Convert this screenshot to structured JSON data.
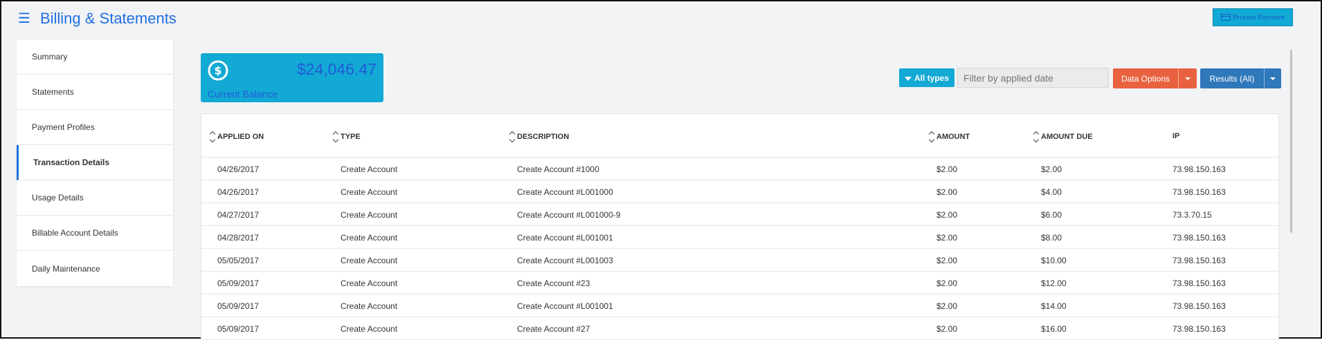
{
  "header": {
    "title": "Billing & Statements",
    "process_payment_label": "Process Payment"
  },
  "sidebar": {
    "items": [
      {
        "label": "Summary"
      },
      {
        "label": "Statements"
      },
      {
        "label": "Payment Profiles"
      },
      {
        "label": "Transaction Details"
      },
      {
        "label": "Usage Details"
      },
      {
        "label": "Billable Account Details"
      },
      {
        "label": "Daily Maintenance"
      }
    ],
    "active_index": 3
  },
  "balance": {
    "amount": "$24,046.47",
    "label": "Current Balance"
  },
  "toolbar": {
    "all_types_label": "All types",
    "date_filter_placeholder": "Filter by applied date",
    "data_options_label": "Data Options",
    "results_label": "Results (All)"
  },
  "table": {
    "columns": [
      "APPLIED ON",
      "TYPE",
      "DESCRIPTION",
      "AMOUNT",
      "AMOUNT DUE",
      "IP"
    ],
    "rows": [
      [
        "04/26/2017",
        "Create Account",
        "Create Account #1000",
        "$2.00",
        "$2.00",
        "73.98.150.163"
      ],
      [
        "04/26/2017",
        "Create Account",
        "Create Account #L001000",
        "$2.00",
        "$4.00",
        "73.98.150.163"
      ],
      [
        "04/27/2017",
        "Create Account",
        "Create Account #L001000-9",
        "$2.00",
        "$6.00",
        "73.3.70.15"
      ],
      [
        "04/28/2017",
        "Create Account",
        "Create Account #L001001",
        "$2.00",
        "$8.00",
        "73.98.150.163"
      ],
      [
        "05/05/2017",
        "Create Account",
        "Create Account #L001003",
        "$2.00",
        "$10.00",
        "73.98.150.163"
      ],
      [
        "05/09/2017",
        "Create Account",
        "Create Account #23",
        "$2.00",
        "$12.00",
        "73.98.150.163"
      ],
      [
        "05/09/2017",
        "Create Account",
        "Create Account #L001001",
        "$2.00",
        "$14.00",
        "73.98.150.163"
      ],
      [
        "05/09/2017",
        "Create Account",
        "Create Account #27",
        "$2.00",
        "$16.00",
        "73.98.150.163"
      ]
    ]
  },
  "colors": {
    "accent_blue": "#1f6fe0",
    "balance_card": "#12a9d4",
    "data_options": "#e9623f",
    "results": "#2f78ba"
  },
  "icons": {
    "menu": "hamburger-icon",
    "payment": "credit-card-icon",
    "balance": "dollar-circle-icon",
    "filter": "filter-icon",
    "sort": "sort-icon",
    "dropdown": "caret-down-icon"
  }
}
